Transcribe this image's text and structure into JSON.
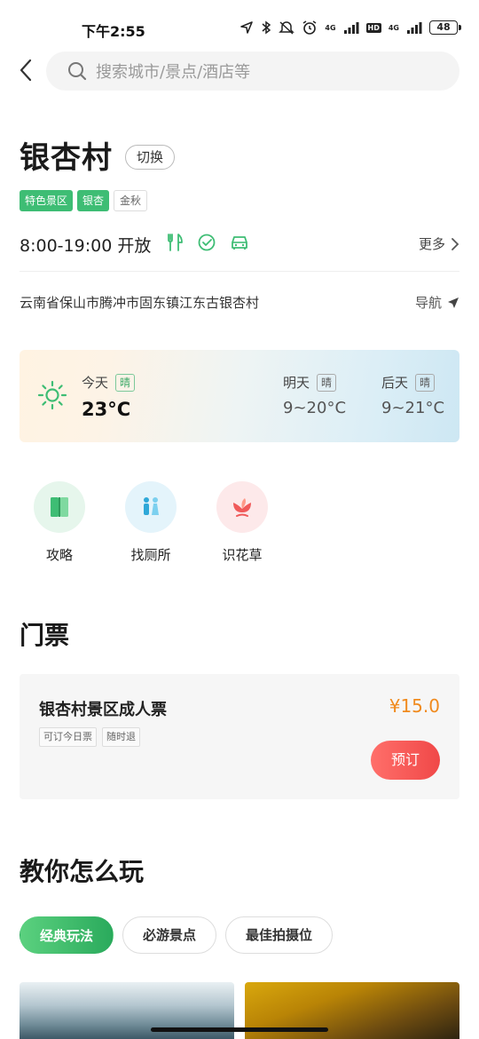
{
  "status_bar": {
    "time": "下午2:55",
    "network_label": "4G",
    "network_label_2": "4G",
    "hd_label": "HD",
    "battery": "48",
    "icons": [
      "location-icon",
      "bluetooth-icon",
      "mute-icon",
      "alarm-icon",
      "signal-icon",
      "battery-icon"
    ]
  },
  "header": {
    "search_placeholder": "搜索城市/景点/酒店等"
  },
  "place": {
    "name": "银杏村",
    "switch_label": "切换",
    "tags": [
      "特色景区",
      "银杏",
      "金秋"
    ],
    "hours": "8:00-19:00 开放",
    "facility_icons": [
      "restaurant-icon",
      "check-circle-icon",
      "parking-car-icon"
    ],
    "more_label": "更多",
    "address": "云南省保山市腾冲市固东镇江东古银杏村",
    "nav_label": "导航"
  },
  "weather": {
    "today": {
      "label": "今天",
      "condition": "晴",
      "temp": "23°C"
    },
    "tomorrow": {
      "label": "明天",
      "condition": "晴",
      "temp": "9~20°C"
    },
    "after": {
      "label": "后天",
      "condition": "晴",
      "temp": "9~21°C"
    }
  },
  "tools": [
    {
      "label": "攻略",
      "icon": "guide-book-icon",
      "bg": "#e6f6ec"
    },
    {
      "label": "找厕所",
      "icon": "toilet-icon",
      "bg": "#e4f4fb"
    },
    {
      "label": "识花草",
      "icon": "plant-recognize-icon",
      "bg": "#fde9ea"
    }
  ],
  "tickets": {
    "section_title": "门票",
    "item": {
      "name": "银杏村景区成人票",
      "price": "¥15.0",
      "tags": [
        "可订今日票",
        "随时退"
      ],
      "book_label": "预订"
    }
  },
  "play": {
    "section_title": "教你怎么玩",
    "tabs": [
      "经典玩法",
      "必游景点",
      "最佳拍摄位"
    ]
  },
  "colors": {
    "accent_green": "#3ebd74",
    "price_orange": "#f08a1d",
    "book_red": "#f04848"
  }
}
